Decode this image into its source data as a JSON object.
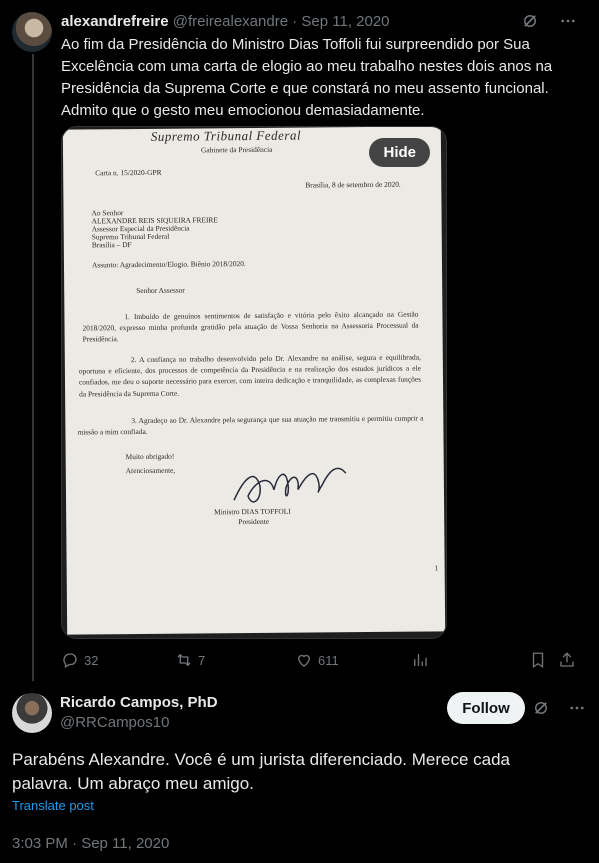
{
  "tweet1": {
    "display_name": "alexandrefreire",
    "handle": "@freirealexandre",
    "separator": "·",
    "date": "Sep 11, 2020",
    "text": "Ao fim da Presidência do Ministro Dias Toffoli fui surpreendido por Sua Excelência com uma carta de elogio ao meu trabalho nestes dois anos na Presidência da Suprema Corte e que constará no meu assento funcional. Admito que o gesto meu emocionou demasiadamente.",
    "media_hide_label": "Hide",
    "replies": "32",
    "reposts": "7",
    "likes": "611",
    "letter": {
      "letterhead": "Supremo Tribunal Federal",
      "office": "Gabinete da Presidência",
      "ref": "Carta n. 15/2020-GPR",
      "date_line": "Brasília, 8 de setembro de 2020.",
      "addr1": "Ao Senhor",
      "addr2": "ALEXANDRE REIS SIQUEIRA FREIRE",
      "addr3": "Assessor Especial da Presidência",
      "addr4": "Supremo Tribunal Federal",
      "addr5": "Brasília – DF",
      "subject": "Assunto: Agradecimento/Elogio. Biênio 2018/2020.",
      "salutation": "Senhor Assessor",
      "para1": "1. Imbuído de genuínos sentimentos de satisfação e vitória pelo êxito alcançado na Gestão 2018/2020, expresso minha profunda gratidão pela atuação de Vossa Senhoria na Assessoria Processual da Presidência.",
      "para2": "2. A confiança no trabalho desenvolvido pelo Dr. Alexandre na análise, segura e equilibrada, oportuna e eficiente, dos processos de competência da Presidência e na realização dos estudos jurídicos a ele confiados, me deu o suporte necessário para exercer, com inteira dedicação e tranquilidade, as complexas funções da Presidência da Suprema Corte.",
      "para3": "3. Agradeço ao Dr. Alexandre pela segurança que sua atuação me transmitiu e permitiu cumprir a missão a mim confiada.",
      "thanks": "Muito obrigado!",
      "closing": "Atenciosamente,",
      "signer": "Ministro DIAS TOFFOLI",
      "signer_title": "Presidente",
      "page_num": "1"
    }
  },
  "tweet2": {
    "display_name": "Ricardo Campos, PhD",
    "handle": "@RRCampos10",
    "follow_label": "Follow",
    "text": "Parabéns Alexandre. Você é um jurista diferenciado. Merece cada palavra. Um abraço meu amigo.",
    "translate_label": "Translate post",
    "timestamp": "3:03 PM · Sep 11, 2020"
  },
  "colors": {
    "background": "#000000",
    "text": "#e7e9ea",
    "muted": "#71767b",
    "link": "#1d9bf0"
  }
}
